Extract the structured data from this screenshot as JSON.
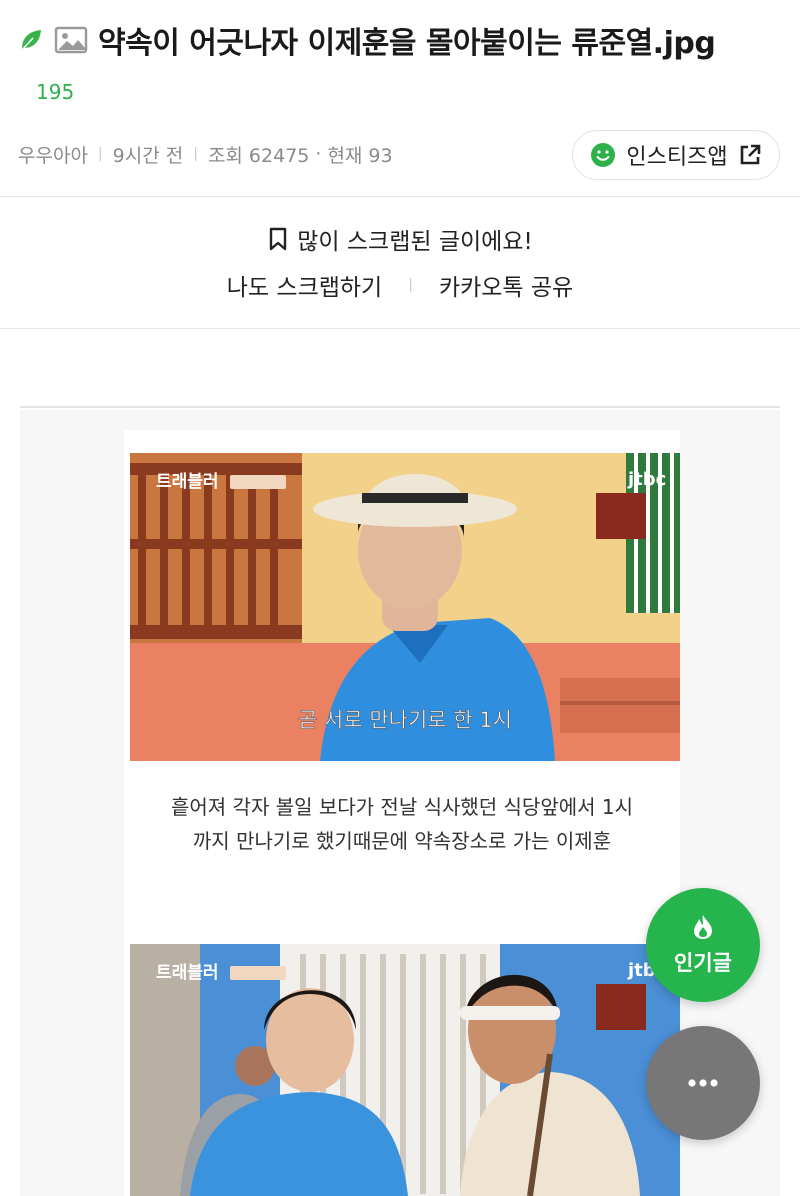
{
  "post": {
    "title": "약속이 어긋나자 이제훈을 몰아붙이는 류준열.jpg",
    "comment_count": "195",
    "author": "우우아아",
    "time_ago": "9시간 전",
    "views_label": "조회 62475",
    "current_label": "현재 93",
    "app_button_label": "인스티즈앱"
  },
  "scrap": {
    "notice": "많이 스크랩된 글이에요!",
    "scrap_action": "나도 스크랩하기",
    "share_action": "카카오톡 공유"
  },
  "content": {
    "frame1": {
      "show_logo": "트래블러",
      "subtitle": "곧 서로 만나기로 한 1시",
      "channel": "jtbc"
    },
    "caption1_line1": "흩어져 각자 볼일 보다가 전날 식사했던  식당앞에서  1시",
    "caption1_line2": "까지 만나기로 했기때문에 약속장소로 가는 이제훈",
    "frame2": {
      "show_logo": "트래블러",
      "channel": "jtbc"
    }
  },
  "floating": {
    "popular_label": "인기글"
  },
  "colors": {
    "accent_green": "#26b54c",
    "count_green": "#2fb04a",
    "more_gray": "#777777"
  },
  "icons": {
    "leaf": "leaf-icon",
    "image": "image-icon",
    "smile": "smile-icon",
    "external": "external-link-icon",
    "bookmark": "bookmark-icon",
    "fire": "fire-icon",
    "more": "more-dots-icon"
  }
}
